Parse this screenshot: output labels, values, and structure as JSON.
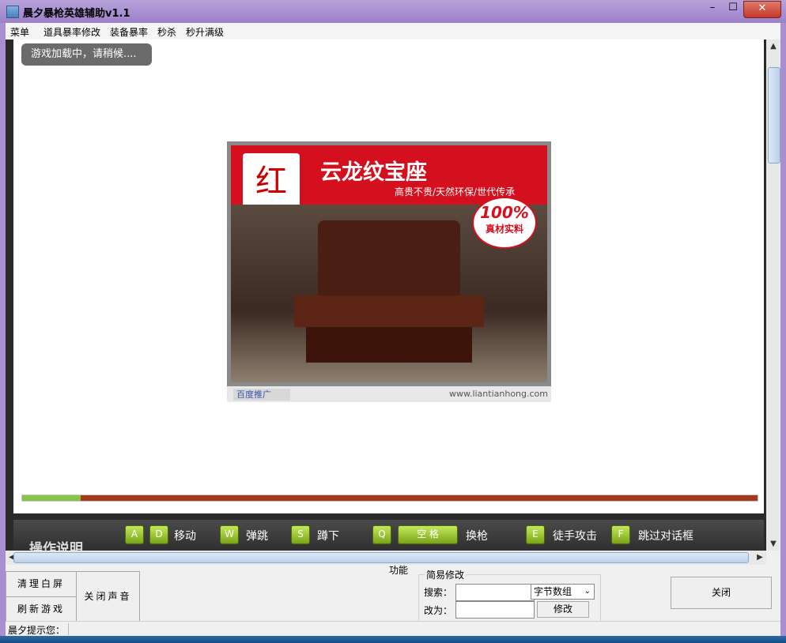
{
  "window": {
    "title": "晨夕暴枪英雄辅助v1.1",
    "min": "–",
    "max": "☐",
    "close": "✕"
  },
  "menu": [
    "菜单",
    "道具暴率修改",
    "装备暴率",
    "秒杀",
    "秒升满级"
  ],
  "game": {
    "loading_text": "游戏加载中，请稍候....",
    "progress_fraction": 0.08,
    "ad": {
      "logo": "红",
      "title": "云龙纹宝座",
      "subtitle": "高贵不贵/天然环保/世代传承",
      "badge_big": "100%",
      "badge_small": "真材实料",
      "baidu": "百度推广",
      "url": "www.liantianhong.com"
    }
  },
  "operation": {
    "title": "操作说明",
    "keys": {
      "a": "A",
      "d": "D",
      "w": "W",
      "s": "S",
      "q": "Q",
      "space": "空 格",
      "e": "E",
      "f": "F"
    },
    "labels": {
      "move": "移动",
      "jump": "弹跳",
      "crouch": "蹲下",
      "swap": "换枪",
      "melee": "徒手攻击",
      "skip": "跳过对话框"
    }
  },
  "scroll": {
    "up": "▲",
    "down": "▼",
    "left": "◀",
    "right": "▶"
  },
  "controls": {
    "func_label": "功能",
    "clear": "清理白屏",
    "refresh": "刷新游戏",
    "mute": "关闭声音",
    "simple_title": "简易修改",
    "search_label": "搜索：",
    "search_value": "",
    "type_select": "字节数组",
    "select_arrow": "⌄",
    "change_label": "改为：",
    "change_value": "",
    "modify": "修改",
    "close": "关闭"
  },
  "status": {
    "label": "晨夕提示您：",
    "text": ""
  }
}
